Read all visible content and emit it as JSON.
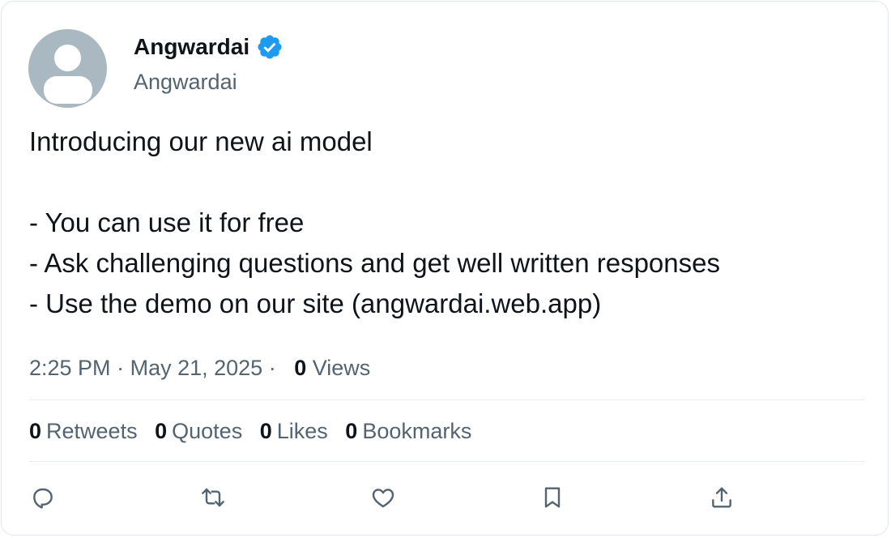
{
  "tweet": {
    "display_name": "Angwardai",
    "handle": "Angwardai",
    "verified": true,
    "text": "Introducing our new ai model\n\n- You can use it for free\n- Ask challenging questions and get well written responses\n- Use the demo on our site (angwardai.web.app)",
    "time": "2:25 PM",
    "date": "May 21, 2025",
    "views_count": "0",
    "views_label": "Views"
  },
  "stats": {
    "retweets": {
      "count": "0",
      "label": "Retweets"
    },
    "quotes": {
      "count": "0",
      "label": "Quotes"
    },
    "likes": {
      "count": "0",
      "label": "Likes"
    },
    "bookmarks": {
      "count": "0",
      "label": "Bookmarks"
    }
  },
  "actions": [
    "reply-icon",
    "retweet-icon",
    "like-icon",
    "bookmark-icon",
    "share-icon"
  ],
  "colors": {
    "verified_badge": "#1d9bf0",
    "secondary_text": "#536471",
    "primary_text": "#0f1419",
    "avatar_bg": "#aab8c2"
  }
}
